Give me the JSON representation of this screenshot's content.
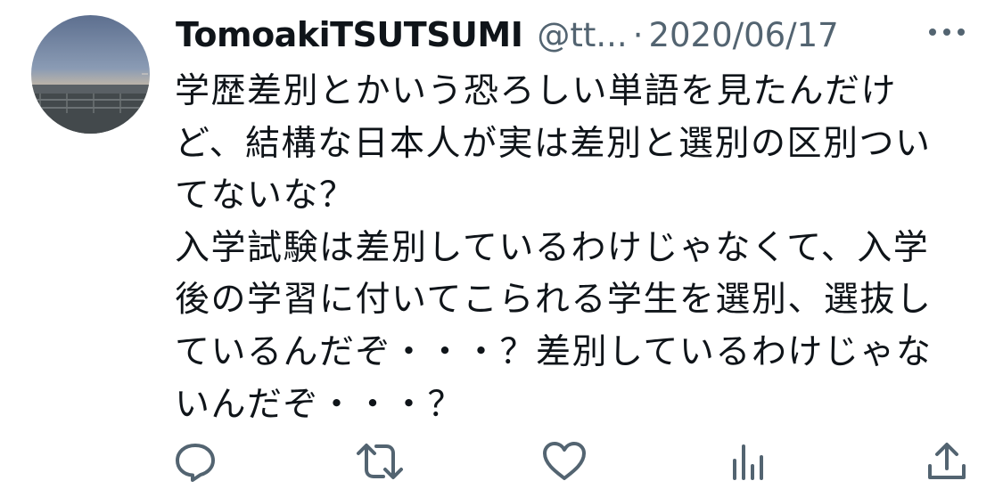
{
  "tweet": {
    "display_name": "TomoakiTSUTSUMI",
    "handle": "@tt...",
    "separator": "·",
    "date": "2020/06/17",
    "text_lines": [
      "学歴差別とかいう恐ろしい単語を見たんだけ",
      "ど、結構な日本人が実は差別と選別の区別つい",
      "てないな？",
      "入学試験は差別しているわけじゃなくて、入学",
      "後の学習に付いてこられる学生を選別、選抜し",
      "ているんだぞ・・・？差別しているわけじゃな",
      "いんだぞ・・・？"
    ]
  },
  "actions": {
    "reply": "reply-icon",
    "retweet": "retweet-icon",
    "like": "heart-icon",
    "analytics": "analytics-icon",
    "share": "share-icon"
  },
  "colors": {
    "text": "#0f1419",
    "secondary": "#536471",
    "background": "#ffffff"
  }
}
